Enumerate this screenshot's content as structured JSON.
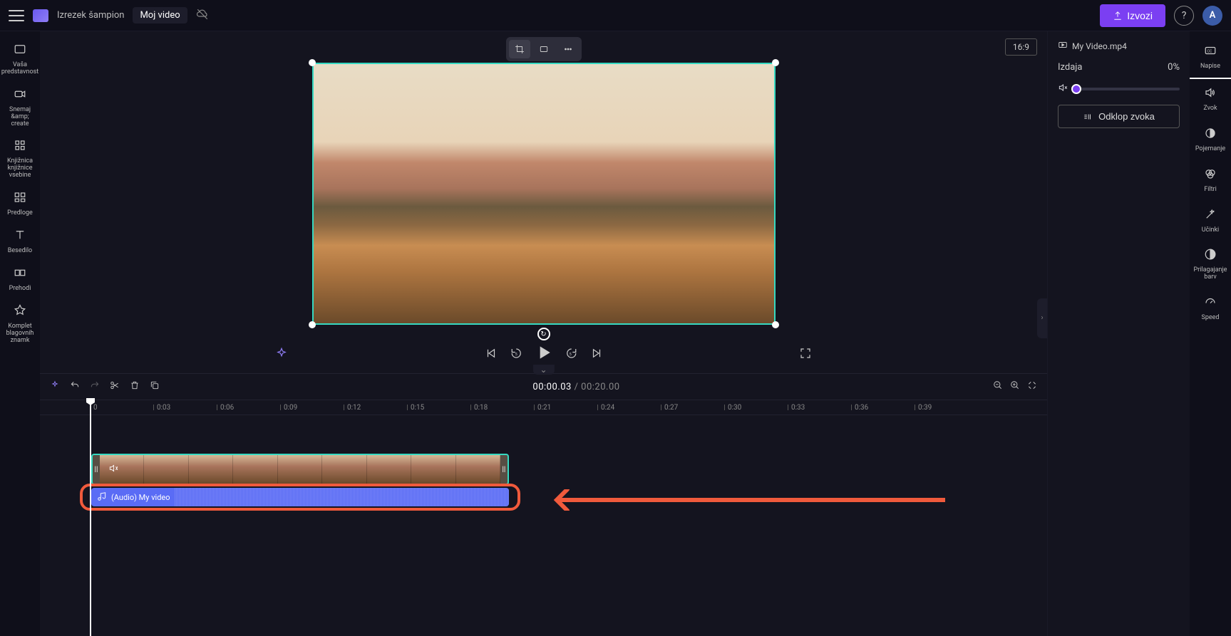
{
  "header": {
    "project_label": "Izrezek šampion",
    "project_title": "Moj video",
    "export_label": "Izvozi",
    "avatar_letter": "A"
  },
  "left_rail": [
    {
      "label": "Vaša predstavnost"
    },
    {
      "label": "Snemaj &amp;\ncreate"
    },
    {
      "label": "Knjižnica knjižnice vsebine"
    },
    {
      "label": "Predloge"
    },
    {
      "label": "Besedilo"
    },
    {
      "label": "Prehodi"
    },
    {
      "label": "Komplet blagovnih znamk"
    }
  ],
  "stage": {
    "aspect": "16:9"
  },
  "playback": {
    "current": "00:00.03",
    "duration": "00:20.00"
  },
  "ruler": [
    "0",
    "0:03",
    "0:06",
    "0:09",
    "0:12",
    "0:15",
    "0:18",
    "0:21",
    "0:24",
    "0:27",
    "0:30",
    "0:33",
    "0:36",
    "0:39"
  ],
  "clip": {
    "audio_label": "(Audio) My video"
  },
  "props": {
    "filename": "My Video.mp4",
    "volume_label": "Izdaja",
    "volume_value": "0%",
    "detach_label": "Odklop zvoka"
  },
  "right_rail": [
    {
      "label": "Napise"
    },
    {
      "label": "Zvok"
    },
    {
      "label": "Pojemanje"
    },
    {
      "label": "Filtri"
    },
    {
      "label": "Učinki"
    },
    {
      "label": "Prilagajanje barv"
    },
    {
      "label": "Speed"
    }
  ]
}
